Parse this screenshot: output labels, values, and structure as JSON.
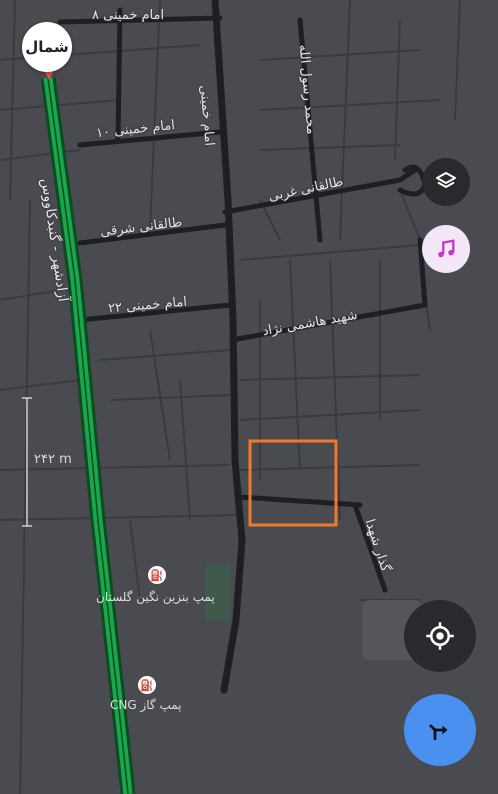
{
  "compass": {
    "label": "شمال"
  },
  "scale": {
    "label": "۲۴۲ m"
  },
  "streets": {
    "khomeini_8": "امام خمینی ۸",
    "khomeini_10": "امام خمینی ۱۰",
    "khomeini_main": "امام خمینی",
    "mohammad_rasoolallah": "محمد رسول الله",
    "taleghani_gharbi": "طالقانی غربی",
    "taleghani_sharghi": "طالقانی شرقی",
    "khomeini_22": "امام خمینی ۲۲",
    "hashemi_nejad": "شهید هاشمی نژاد",
    "azadshahr_gonbad": "آزادشهر - گنبدکاووس",
    "gozar_shohada": "گذار شهدا"
  },
  "pois": {
    "gas_station": "پمپ بنزین نگین گلستان",
    "cng_station": "پمپ گاز CNG"
  },
  "buttons": {
    "layers": "layers-icon",
    "music": "music-note-icon",
    "locate": "my-location-icon",
    "directions": "directions-icon"
  },
  "colors": {
    "map_bg": "#4a4a51",
    "road": "#1f1f23",
    "highway": "#1aa64a",
    "highlight": "#f07a2a",
    "directions_btn": "#4a90f0"
  }
}
